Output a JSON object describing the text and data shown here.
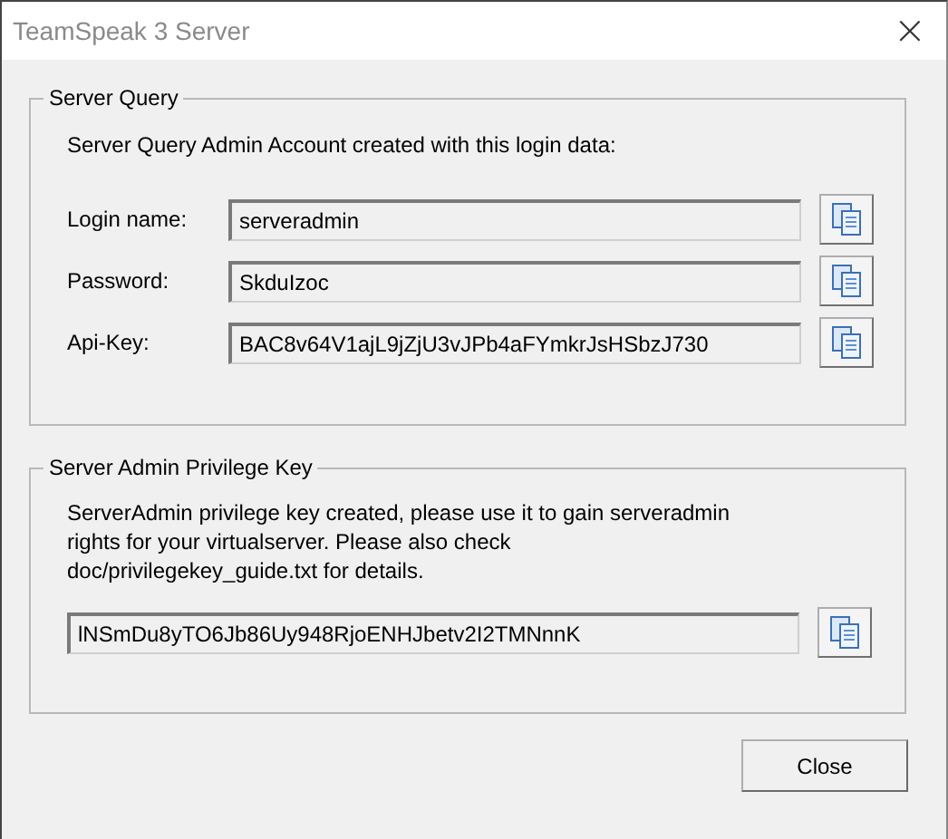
{
  "window": {
    "title": "TeamSpeak 3 Server",
    "close_glyph": "×"
  },
  "server_query": {
    "title": "Server Query",
    "intro": "Server Query Admin Account created with this login data:",
    "fields": [
      {
        "label": "Login name:",
        "value": "serveradmin"
      },
      {
        "label": "Password:",
        "value": "SkduIzoc"
      },
      {
        "label": "Api-Key:",
        "value": "BAC8v64V1ajL9jZjU3vJPb4aFYmkrJsHSbzJ730"
      }
    ]
  },
  "privilege_key": {
    "title": "Server Admin Privilege Key",
    "message": "ServerAdmin privilege key created, please use it to gain serveradmin\nrights for your virtualserver. Please also check\ndoc/privilegekey_guide.txt for details.",
    "value": "lNSmDu8yTO6Jb86Uy948RjoENHJbetv2I2TMNnnK"
  },
  "buttons": [
    "Close"
  ]
}
